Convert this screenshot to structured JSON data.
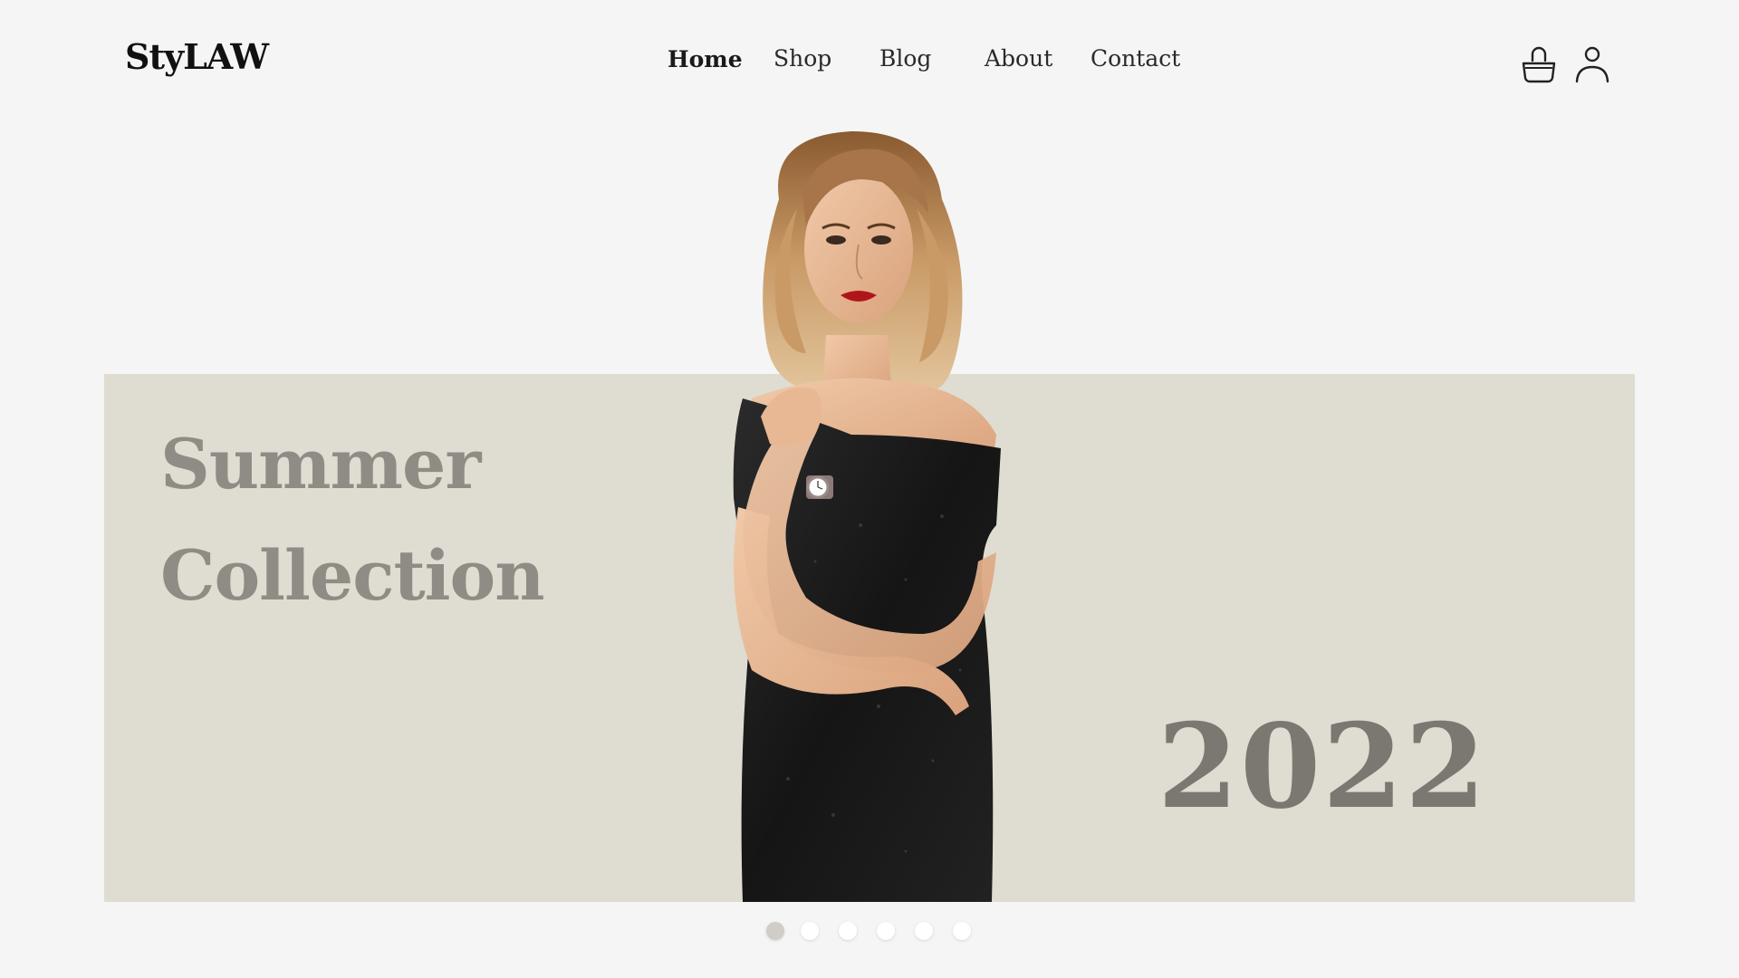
{
  "brand": {
    "logo": "StyLAW"
  },
  "nav": {
    "items": [
      {
        "label": "Home",
        "active": true
      },
      {
        "label": "Shop",
        "active": false
      },
      {
        "label": "Blog",
        "active": false
      },
      {
        "label": "About",
        "active": false
      },
      {
        "label": "Contact",
        "active": false
      }
    ]
  },
  "header_icons": {
    "cart": "shopping-basket-icon",
    "account": "user-icon"
  },
  "hero": {
    "title_line1": "Summer",
    "title_line2": "Collection",
    "year": "2022",
    "image": "model-in-black-dress"
  },
  "carousel": {
    "slide_count": 6,
    "active_index": 0
  },
  "colors": {
    "background": "#f5f5f5",
    "hero_band": "#dfdcd1",
    "title_text": "#8f8c86",
    "year_text": "#7b7871",
    "active_dot": "#cfcdc6"
  }
}
